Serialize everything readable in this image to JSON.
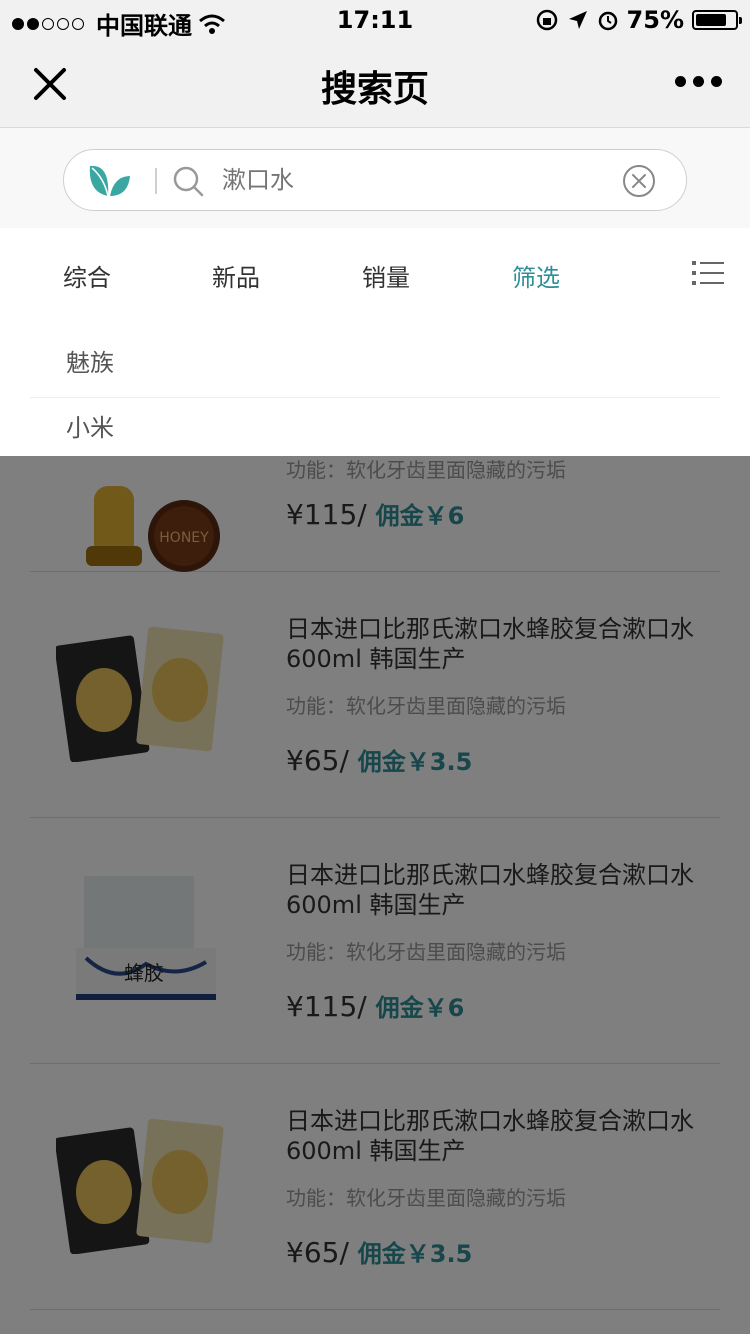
{
  "status_bar": {
    "carrier": "中国联通",
    "time": "17:11",
    "battery": "75%"
  },
  "nav": {
    "title": "搜索页",
    "close_icon": "close-icon",
    "more_icon": "more-icon"
  },
  "search": {
    "placeholder": "漱口水",
    "value": "",
    "leaf_icon": "leaf-logo-icon",
    "search_icon": "search-icon",
    "clear_icon": "clear-icon"
  },
  "tabs": [
    {
      "label": "综合",
      "active": false
    },
    {
      "label": "新品",
      "active": false
    },
    {
      "label": "销量",
      "active": false
    },
    {
      "label": "筛选",
      "active": true
    }
  ],
  "filter_options": [
    "魅族",
    "小米"
  ],
  "products": [
    {
      "title": "",
      "desc": "功能：软化牙齿里面隐藏的污垢",
      "price": "¥115/",
      "commission": "佣金￥6",
      "image": "honey-jar"
    },
    {
      "title": "日本进口比那氏漱口水蜂胶复合漱口水600ml 韩国生产",
      "desc": "功能：软化牙齿里面隐藏的污垢",
      "price": "¥65/",
      "commission": "佣金￥3.5",
      "image": "honey-mask"
    },
    {
      "title": "日本进口比那氏漱口水蜂胶复合漱口水600ml 韩国生产",
      "desc": "功能：软化牙齿里面隐藏的污垢",
      "price": "¥115/",
      "commission": "佣金￥6",
      "image": "gift-box"
    },
    {
      "title": "日本进口比那氏漱口水蜂胶复合漱口水600ml 韩国生产",
      "desc": "功能：软化牙齿里面隐藏的污垢",
      "price": "¥65/",
      "commission": "佣金￥3.5",
      "image": "honey-mask"
    }
  ],
  "colors": {
    "accent": "#2f8f96",
    "overlay": "rgba(0,0,0,0.5)"
  }
}
